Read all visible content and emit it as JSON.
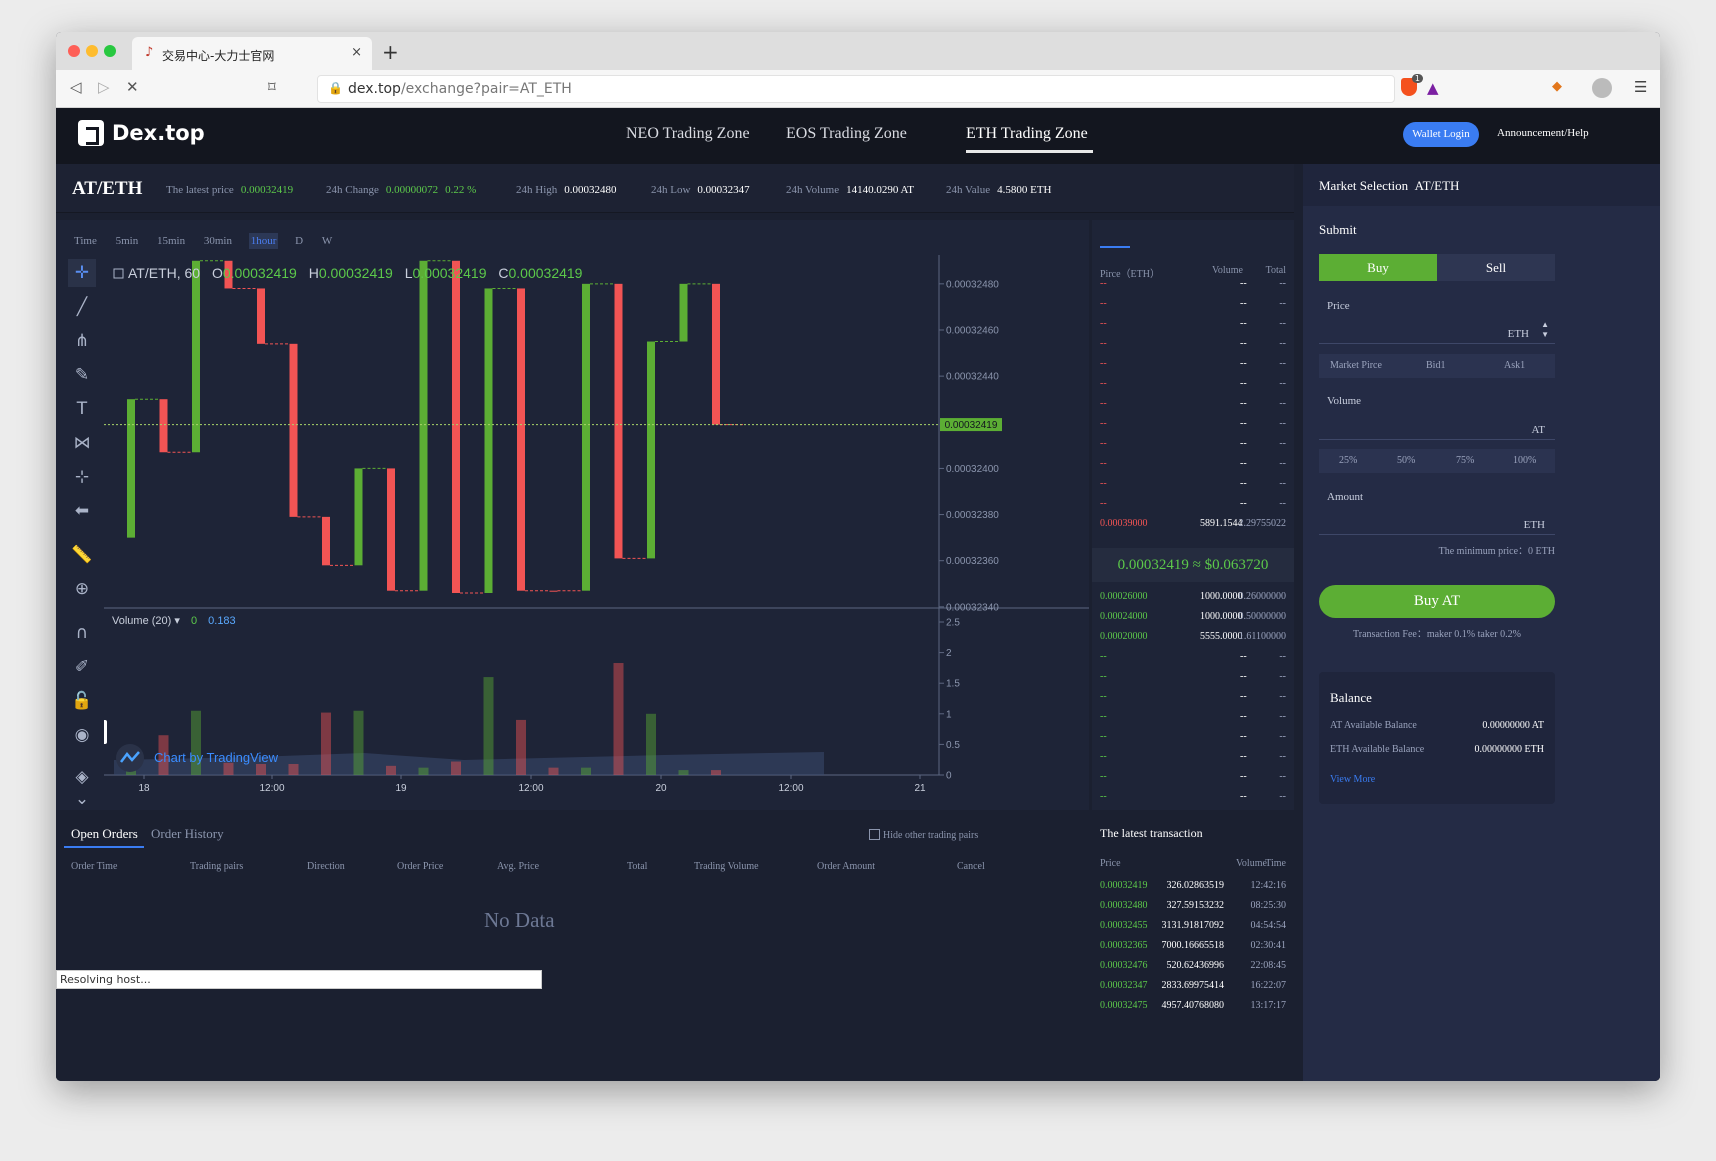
{
  "browser": {
    "tab_title": "交易中心-大力士官网",
    "tab_close": "×",
    "new_tab": "+",
    "url_domain": "dex.top",
    "url_path": "/exchange?pair=AT_ETH",
    "badge": "1",
    "status": "Resolving host..."
  },
  "nav": {
    "logo": "Dex.top",
    "zones": [
      "NEO Trading Zone",
      "EOS Trading Zone",
      "ETH Trading Zone"
    ],
    "active_zone": 2,
    "wallet_login": "Wallet Login",
    "announcement": "Announcement/Help"
  },
  "ticker": {
    "pair": "AT/ETH",
    "latest_label": "The latest price",
    "latest": "0.00032419",
    "change_label": "24h Change",
    "change": "0.00000072",
    "change_pct": "0.22 %",
    "high_label": "24h High",
    "high": "0.00032480",
    "low_label": "24h Low",
    "low": "0.00032347",
    "volume_label": "24h Volume",
    "volume": "14140.0290 AT",
    "value_label": "24h Value",
    "value": "4.5800 ETH"
  },
  "timeframes": {
    "items": [
      "Time",
      "5min",
      "15min",
      "30min",
      "1hour",
      "D",
      "W"
    ],
    "active": 4
  },
  "chart_data": {
    "type": "candlestick",
    "symbol": "AT/ETH, 60",
    "ohlc_prefix": [
      "O",
      "H",
      "L",
      "C"
    ],
    "ohlc": [
      "0.00032419",
      "0.00032419",
      "0.00032419",
      "0.00032419"
    ],
    "ylim": [
      0.000323395,
      0.000324925
    ],
    "price_ticks": [
      "0.00032480",
      "0.00032460",
      "0.00032440",
      "0.00032400",
      "0.00032380",
      "0.00032360",
      "0.00032340"
    ],
    "current_price_label": "0.00032419",
    "x_ticks": [
      "18",
      "12:00",
      "19",
      "12:00",
      "20",
      "12:00",
      "21"
    ],
    "candles": [
      {
        "o": 0.0003237,
        "c": 0.0003243,
        "up": true
      },
      {
        "o": 0.0003243,
        "c": 0.00032407,
        "up": false
      },
      {
        "o": 0.00032407,
        "c": 0.0003249,
        "up": true
      },
      {
        "o": 0.0003249,
        "c": 0.00032478,
        "up": false
      },
      {
        "o": 0.00032478,
        "c": 0.00032454,
        "up": false
      },
      {
        "o": 0.00032454,
        "c": 0.00032379,
        "up": false
      },
      {
        "o": 0.00032379,
        "c": 0.00032358,
        "up": false
      },
      {
        "o": 0.00032358,
        "c": 0.000324,
        "up": true
      },
      {
        "o": 0.000324,
        "c": 0.00032347,
        "up": false
      },
      {
        "o": 0.00032347,
        "c": 0.0003249,
        "up": true
      },
      {
        "o": 0.0003249,
        "c": 0.00032346,
        "up": false
      },
      {
        "o": 0.00032346,
        "c": 0.00032478,
        "up": true
      },
      {
        "o": 0.00032478,
        "c": 0.00032347,
        "up": false
      },
      {
        "o": 0.00032347,
        "c": 0.00032347,
        "up": false
      },
      {
        "o": 0.00032347,
        "c": 0.0003248,
        "up": true
      },
      {
        "o": 0.0003248,
        "c": 0.00032361,
        "up": false
      },
      {
        "o": 0.00032361,
        "c": 0.00032455,
        "up": true
      },
      {
        "o": 0.00032455,
        "c": 0.0003248,
        "up": true
      },
      {
        "o": 0.0003248,
        "c": 0.00032419,
        "up": false
      }
    ],
    "volume_label": "Volume (20)",
    "volume_values": [
      "0",
      "0.183"
    ],
    "volume_ylim": [
      0,
      2.5
    ],
    "volume_ticks": [
      "2.5",
      "2",
      "1.5",
      "1",
      "0.5",
      "0"
    ],
    "volumes": [
      0.18,
      0.65,
      1.05,
      0.2,
      0.18,
      0.18,
      1.02,
      1.05,
      0.15,
      0.12,
      0.22,
      1.6,
      0.9,
      0.12,
      0.12,
      1.83,
      1.0,
      0.08,
      0.08
    ],
    "watermark": "Chart by TradingView"
  },
  "orderbook": {
    "header": [
      "Pirce（ETH）",
      "Volume",
      "Total"
    ],
    "placeholder": "--",
    "asks": [
      {
        "price": "0.00039000",
        "volume": "5891.1544",
        "total": "2.29755022"
      }
    ],
    "last": "0.00032419 ≈ $0.063720",
    "bids": [
      {
        "price": "0.00026000",
        "volume": "1000.0000",
        "total": "0.26000000"
      },
      {
        "price": "0.00024000",
        "volume": "1000.0000",
        "total": "0.50000000"
      },
      {
        "price": "0.00020000",
        "volume": "5555.0000",
        "total": "1.61100000"
      }
    ]
  },
  "market": {
    "selection_label": "Market Selection",
    "pair": "AT/ETH",
    "submit": "Submit",
    "buy": "Buy",
    "sell": "Sell",
    "price_label": "Price",
    "price_unit": "ETH",
    "quick": [
      "Market Pirce",
      "Bid1",
      "Ask1"
    ],
    "volume_label": "Volume",
    "volume_unit": "AT",
    "pct": [
      "25%",
      "50%",
      "75%",
      "100%"
    ],
    "amount_label": "Amount",
    "amount_unit": "ETH",
    "min_price": "The minimum price：0 ETH",
    "buy_button": "Buy AT",
    "fee": "Transaction Fee：maker 0.1% taker 0.2%",
    "balance_title": "Balance",
    "at_label": "AT Available Balance",
    "at_value": "0.00000000 AT",
    "eth_label": "ETH Available Balance",
    "eth_value": "0.00000000 ETH",
    "view_more": "View More"
  },
  "orders": {
    "tab_open": "Open Orders",
    "tab_history": "Order History",
    "hide_pairs": "Hide other trading pairs",
    "columns": [
      "Order Time",
      "Trading pairs",
      "Direction",
      "Order Price",
      "Avg. Price",
      "Total",
      "Trading Volume",
      "Order Amount",
      "Cancel"
    ],
    "no_data": "No Data"
  },
  "trades": {
    "title": "The latest transaction",
    "header": [
      "Price",
      "Volume",
      "Time"
    ],
    "rows": [
      {
        "price": "0.00032419",
        "volume": "326.02863519",
        "time": "12:42:16"
      },
      {
        "price": "0.00032480",
        "volume": "327.59153232",
        "time": "08:25:30"
      },
      {
        "price": "0.00032455",
        "volume": "3131.91817092",
        "time": "04:54:54"
      },
      {
        "price": "0.00032365",
        "volume": "7000.16665518",
        "time": "02:30:41"
      },
      {
        "price": "0.00032476",
        "volume": "520.62436996",
        "time": "22:08:45"
      },
      {
        "price": "0.00032347",
        "volume": "2833.69975414",
        "time": "16:22:07"
      },
      {
        "price": "0.00032475",
        "volume": "4957.40768080",
        "time": "13:17:17"
      }
    ]
  },
  "colors": {
    "up": "#5cae34",
    "down": "#f25454",
    "accent": "#3a7cf2"
  },
  "icons": {
    "tools": [
      "crosshair-icon",
      "trend-line-icon",
      "pitchfork-icon",
      "brush-icon",
      "text-icon",
      "pattern-icon",
      "prediction-icon",
      "arrow-left-icon",
      "ruler-icon",
      "zoom-in-icon",
      "magnet-icon",
      "lock-draw-icon",
      "unlock-icon",
      "eye-icon",
      "layers-icon",
      "chevron-down-icon"
    ]
  }
}
